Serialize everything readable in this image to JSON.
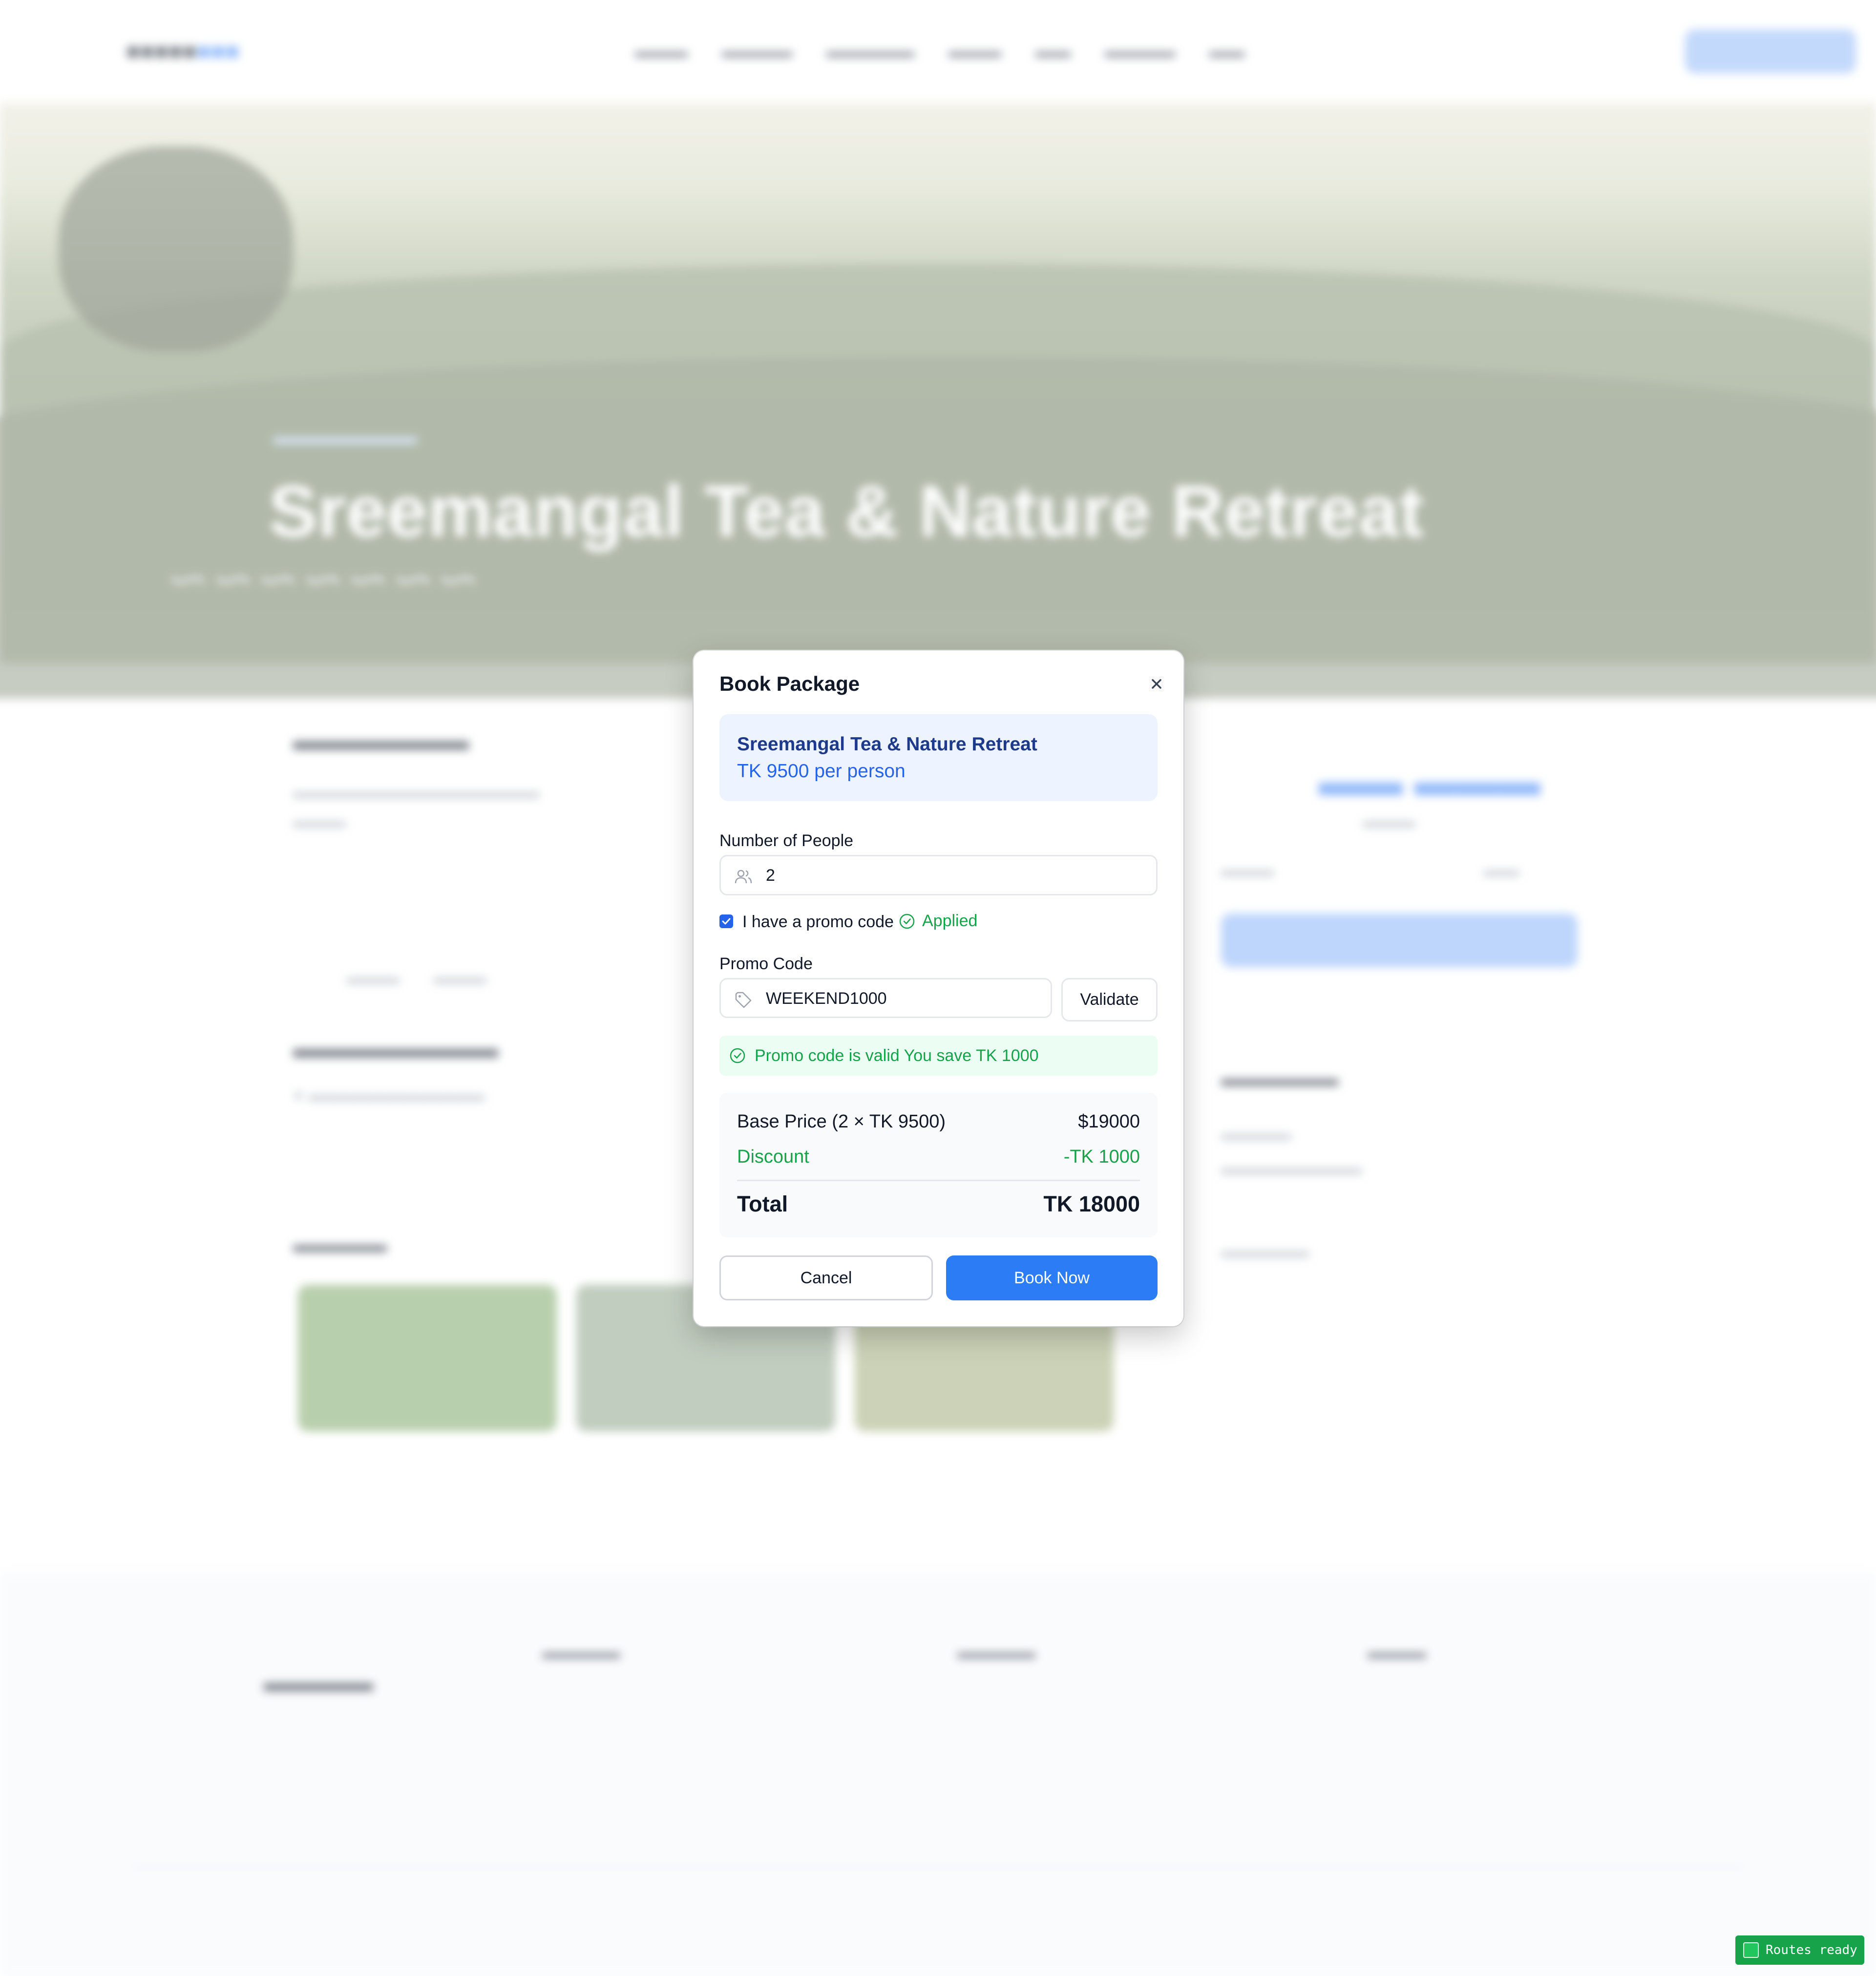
{
  "modal": {
    "title": "Book Package",
    "package_name": "Sreemangal Tea & Nature Retreat",
    "package_price": "TK 9500 per person",
    "people_label": "Number of People",
    "people_value": "2",
    "promo_checkbox_label": "I have a promo code",
    "promo_checked": true,
    "promo_applied": "Applied",
    "promo_label": "Promo Code",
    "promo_value": "WEEKEND1000",
    "validate_label": "Validate",
    "promo_message": "Promo code is valid You save TK 1000",
    "summary": {
      "base_label": "Base Price (2 × TK 9500)",
      "base_value": "$19000",
      "discount_label": "Discount",
      "discount_value": "-TK 1000",
      "total_label": "Total",
      "total_value": "TK 18000"
    },
    "cancel_label": "Cancel",
    "book_label": "Book Now"
  },
  "background": {
    "hero_title": "Sreemangal Tea & Nature Retreat"
  },
  "status_badge": "Routes ready",
  "colors": {
    "primary": "#2b7cf5",
    "success": "#16a34a",
    "package_box": "#eef4ff"
  }
}
